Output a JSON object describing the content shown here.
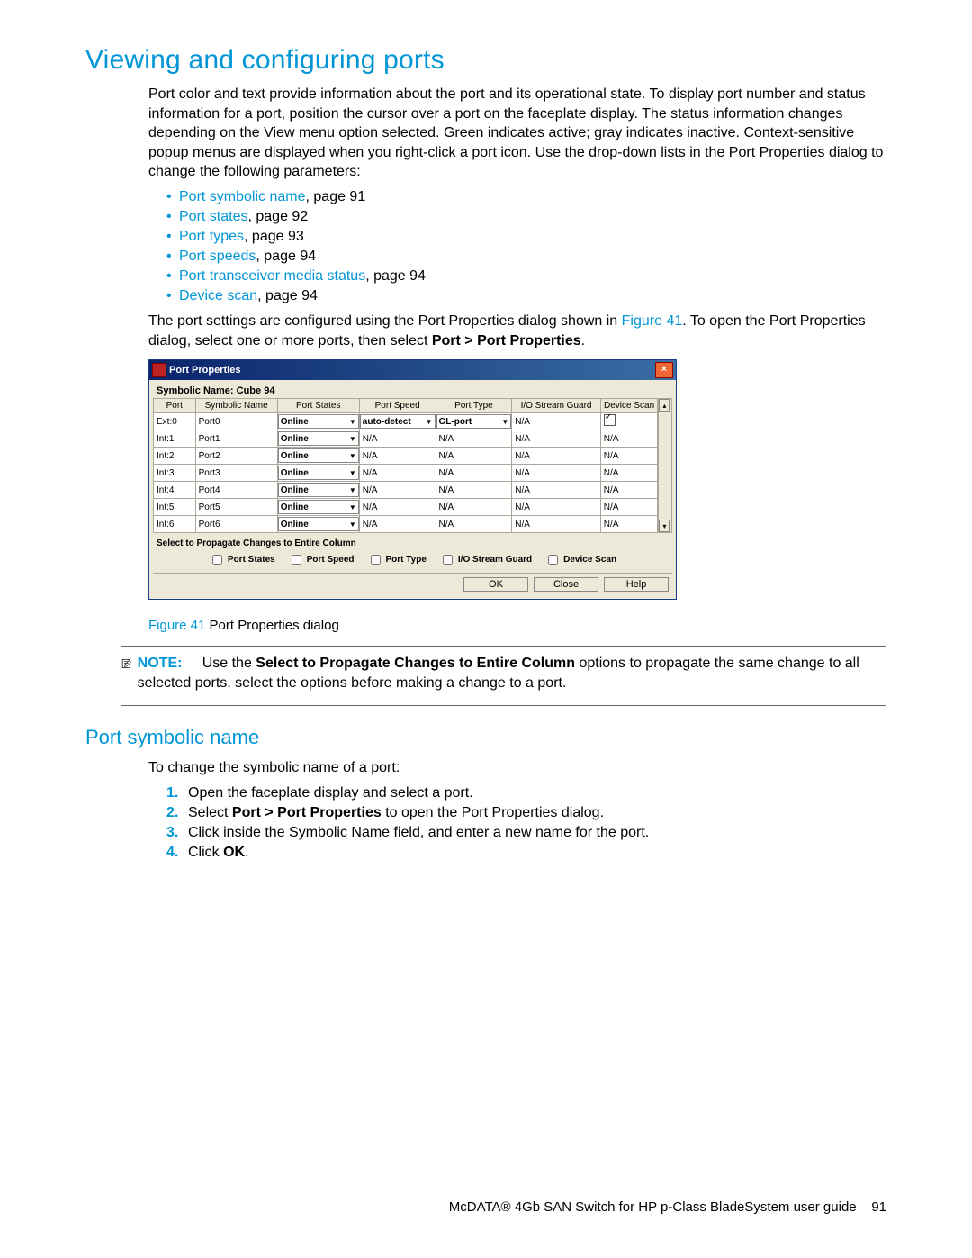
{
  "header": "Viewing and configuring ports",
  "intro": "Port color and text provide information about the port and its operational state. To display port number and status information for a port, position the cursor over a port on the faceplate display. The status information changes depending on the View menu option selected. Green indicates active; gray indicates inactive. Context-sensitive popup menus are displayed when you right-click a port icon. Use the drop-down lists in the Port Properties dialog to change the following parameters:",
  "bullets": [
    {
      "link": "Port symbolic name",
      "rest": ", page 91"
    },
    {
      "link": "Port states",
      "rest": ", page 92"
    },
    {
      "link": "Port types",
      "rest": ", page 93"
    },
    {
      "link": "Port speeds",
      "rest": ", page 94"
    },
    {
      "link": "Port transceiver media status",
      "rest": ", page 94"
    },
    {
      "link": "Device scan",
      "rest": ", page 94"
    }
  ],
  "para2_pre": "The port settings are configured using the Port Properties dialog shown in ",
  "para2_link": "Figure 41",
  "para2_post": ". To open the Port Properties dialog, select one or more ports, then select ",
  "para2_bold": "Port > Port Properties",
  "para2_end": ".",
  "dialog": {
    "title": "Port Properties",
    "sym_label": "Symbolic Name: Cube 94",
    "headers": [
      "Port",
      "Symbolic Name",
      "Port States",
      "Port Speed",
      "Port Type",
      "I/O Stream Guard",
      "Device Scan"
    ],
    "rows": [
      {
        "port": "Ext:0",
        "sym": "Port0",
        "state": "Online",
        "speed": "auto-detect",
        "type": "GL-port",
        "iosg": "N/A",
        "scan": "check"
      },
      {
        "port": "Int:1",
        "sym": "Port1",
        "state": "Online",
        "speed": "N/A",
        "type": "N/A",
        "iosg": "N/A",
        "scan": "N/A"
      },
      {
        "port": "Int:2",
        "sym": "Port2",
        "state": "Online",
        "speed": "N/A",
        "type": "N/A",
        "iosg": "N/A",
        "scan": "N/A"
      },
      {
        "port": "Int:3",
        "sym": "Port3",
        "state": "Online",
        "speed": "N/A",
        "type": "N/A",
        "iosg": "N/A",
        "scan": "N/A"
      },
      {
        "port": "Int:4",
        "sym": "Port4",
        "state": "Online",
        "speed": "N/A",
        "type": "N/A",
        "iosg": "N/A",
        "scan": "N/A"
      },
      {
        "port": "Int:5",
        "sym": "Port5",
        "state": "Online",
        "speed": "N/A",
        "type": "N/A",
        "iosg": "N/A",
        "scan": "N/A"
      },
      {
        "port": "Int:6",
        "sym": "Port6",
        "state": "Online",
        "speed": "N/A",
        "type": "N/A",
        "iosg": "N/A",
        "scan": "N/A"
      }
    ],
    "propagate": "Select to Propagate Changes to Entire Column",
    "checks": [
      "Port States",
      "Port Speed",
      "Port Type",
      "I/O Stream Guard",
      "Device Scan"
    ],
    "ok": "OK",
    "close": "Close",
    "help": "Help"
  },
  "fig_pre": "Figure 41",
  "fig_post": " Port Properties dialog",
  "note_label": "NOTE:",
  "note_pre": "Use the ",
  "note_bold": "Select to Propagate Changes to Entire Column",
  "note_post": " options to propagate the same change to all selected ports, select the options before making a change to a port.",
  "h2": "Port symbolic name",
  "h2_intro": "To change the symbolic name of a port:",
  "steps": [
    {
      "t": "Open the faceplate display and select a port."
    },
    {
      "pre": "Select ",
      "b": "Port > Port Properties",
      "post": " to open the Port Properties dialog."
    },
    {
      "t": "Click inside the Symbolic Name field, and enter a new name for the port."
    },
    {
      "pre": "Click ",
      "b": "OK",
      "post": "."
    }
  ],
  "footer_doc": "McDATA® 4Gb SAN Switch for HP p-Class BladeSystem user guide",
  "footer_page": "91"
}
